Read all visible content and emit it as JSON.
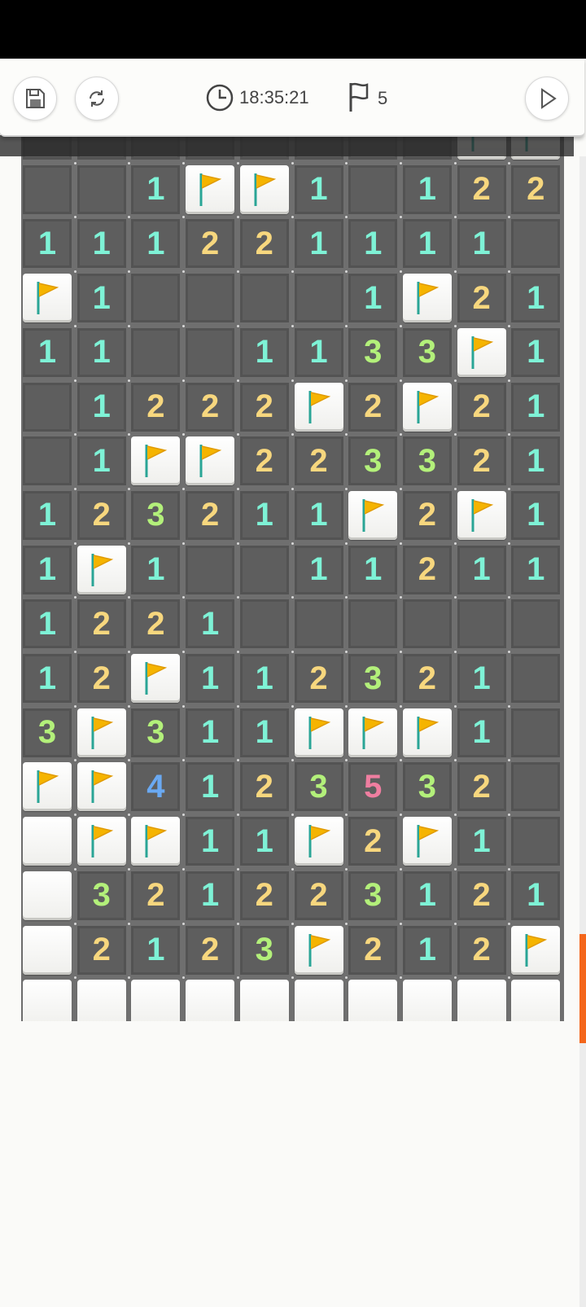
{
  "toolbar": {
    "save_icon": "save-icon",
    "restart_icon": "restart-icon",
    "clock_icon": "clock-icon",
    "time": "18:35:21",
    "flag_icon": "flag-outline-icon",
    "flag_count": "5",
    "play_icon": "play-icon"
  },
  "colors": {
    "one": "#7ef2d6",
    "two": "#f7d77e",
    "three": "#b3f07a",
    "four": "#6aa9f2",
    "five": "#ef7ea0",
    "flag": "#f5b400",
    "accent": "#f4661b"
  },
  "board": {
    "cols": 10,
    "rows": [
      [
        "",
        "",
        "",
        "",
        "",
        "",
        "",
        "",
        "F",
        "F"
      ],
      [
        "",
        "",
        "1",
        "F",
        "F",
        "1",
        "",
        "1",
        "2",
        "2"
      ],
      [
        "1",
        "1",
        "1",
        "2",
        "2",
        "1",
        "1",
        "1",
        "1",
        ""
      ],
      [
        "F",
        "1",
        "",
        "",
        "",
        "",
        "1",
        "F",
        "2",
        "1"
      ],
      [
        "1",
        "1",
        "",
        "",
        "1",
        "1",
        "3",
        "3",
        "F",
        "1"
      ],
      [
        "",
        "1",
        "2",
        "2",
        "2",
        "F",
        "2",
        "F",
        "2",
        "1"
      ],
      [
        "",
        "1",
        "F",
        "F",
        "2",
        "2",
        "3",
        "3",
        "2",
        "1"
      ],
      [
        "1",
        "2",
        "3",
        "2",
        "1",
        "1",
        "F",
        "2",
        "F",
        "1"
      ],
      [
        "1",
        "F",
        "1",
        "",
        "",
        "1",
        "1",
        "2",
        "1",
        "1"
      ],
      [
        "1",
        "2",
        "2",
        "1",
        "",
        "",
        "",
        "",
        "",
        ""
      ],
      [
        "1",
        "2",
        "F",
        "1",
        "1",
        "2",
        "3",
        "2",
        "1",
        ""
      ],
      [
        "3",
        "F",
        "3",
        "1",
        "1",
        "F",
        "F",
        "F",
        "1",
        ""
      ],
      [
        "F",
        "F",
        "4",
        "1",
        "2",
        "3",
        "5",
        "3",
        "2",
        ""
      ],
      [
        "H",
        "F",
        "F",
        "1",
        "1",
        "F",
        "2",
        "F",
        "1",
        ""
      ],
      [
        "H",
        "3",
        "2",
        "1",
        "2",
        "2",
        "3",
        "1",
        "2",
        "1"
      ],
      [
        "H",
        "2",
        "1",
        "2",
        "3",
        "F",
        "2",
        "1",
        "2",
        "F"
      ],
      [
        "H",
        "H",
        "H",
        "H",
        "H",
        "H",
        "H",
        "H",
        "H",
        "H"
      ]
    ]
  }
}
